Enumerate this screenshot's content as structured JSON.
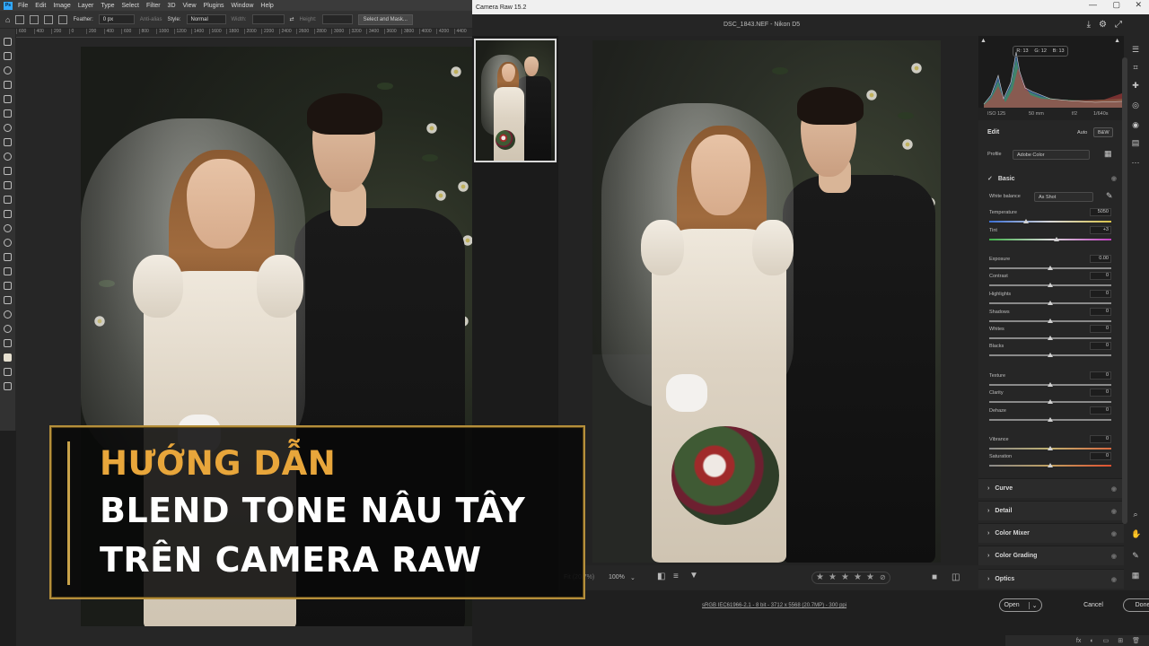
{
  "photoshop": {
    "menu": [
      "File",
      "Edit",
      "Image",
      "Layer",
      "Type",
      "Select",
      "Filter",
      "3D",
      "View",
      "Plugins",
      "Window",
      "Help"
    ],
    "options": {
      "feather_label": "Feather:",
      "feather_value": "0 px",
      "antialias_label": "Anti-alias",
      "style_label": "Style:",
      "style_value": "Normal",
      "width_label": "Width:",
      "height_label": "Height:",
      "select_mask_label": "Select and Mask..."
    },
    "ruler": [
      "600",
      "400",
      "200",
      "0",
      "200",
      "400",
      "600",
      "800",
      "1000",
      "1200",
      "1400",
      "1600",
      "1800",
      "2000",
      "2200",
      "2400",
      "2600",
      "2800",
      "3000",
      "3200",
      "3400",
      "3600",
      "3800",
      "4000",
      "4200",
      "4400"
    ]
  },
  "camera_raw": {
    "window_title": "Camera Raw 15.2",
    "filename": "DSC_1843.NEF  -  Nikon D5",
    "histogram": {
      "r": "R: 13",
      "g": "G: 12",
      "b": "B: 13"
    },
    "camera_info": {
      "iso": "ISO 125",
      "focal": "50 mm",
      "aperture": "f/2",
      "shutter": "1/640s"
    },
    "edit": {
      "title": "Edit",
      "auto_label": "Auto",
      "bw_label": "B&W",
      "profile_label": "Profile",
      "profile_value": "Adobe Color"
    },
    "basic": {
      "title": "Basic",
      "white_balance_label": "White balance",
      "white_balance_value": "As Shot",
      "sliders": [
        {
          "label": "Temperature",
          "value": "5050"
        },
        {
          "label": "Tint",
          "value": "+3"
        },
        {
          "label": "Exposure",
          "value": "0.00"
        },
        {
          "label": "Contrast",
          "value": "0"
        },
        {
          "label": "Highlights",
          "value": "0"
        },
        {
          "label": "Shadows",
          "value": "0"
        },
        {
          "label": "Whites",
          "value": "0"
        },
        {
          "label": "Blacks",
          "value": "0"
        },
        {
          "label": "Texture",
          "value": "0"
        },
        {
          "label": "Clarity",
          "value": "0"
        },
        {
          "label": "Dehaze",
          "value": "0"
        },
        {
          "label": "Vibrance",
          "value": "0"
        },
        {
          "label": "Saturation",
          "value": "0"
        }
      ]
    },
    "sections": [
      "Curve",
      "Detail",
      "Color Mixer",
      "Color Grading",
      "Optics"
    ],
    "bottom": {
      "fit_label": "Fit (20.7%)",
      "zoom_label": "100%",
      "stars": [
        "★",
        "★",
        "★",
        "★",
        "★"
      ]
    },
    "footer": {
      "info": "sRGB IEC61966-2.1 - 8 bit - 3712 x 5568 (20.7MP) - 300 ppi",
      "open_label": "Open",
      "cancel_label": "Cancel",
      "done_label": "Done"
    }
  },
  "overlay": {
    "line1": "HƯỚNG DẪN",
    "line2": "BLEND TONE NÂU TÂY",
    "line3": "TRÊN CAMERA RAW"
  },
  "colors": {
    "title_gold": "#e8a63b",
    "frame_gold": "#b58f3b",
    "ps_blue": "#31a8ff"
  }
}
